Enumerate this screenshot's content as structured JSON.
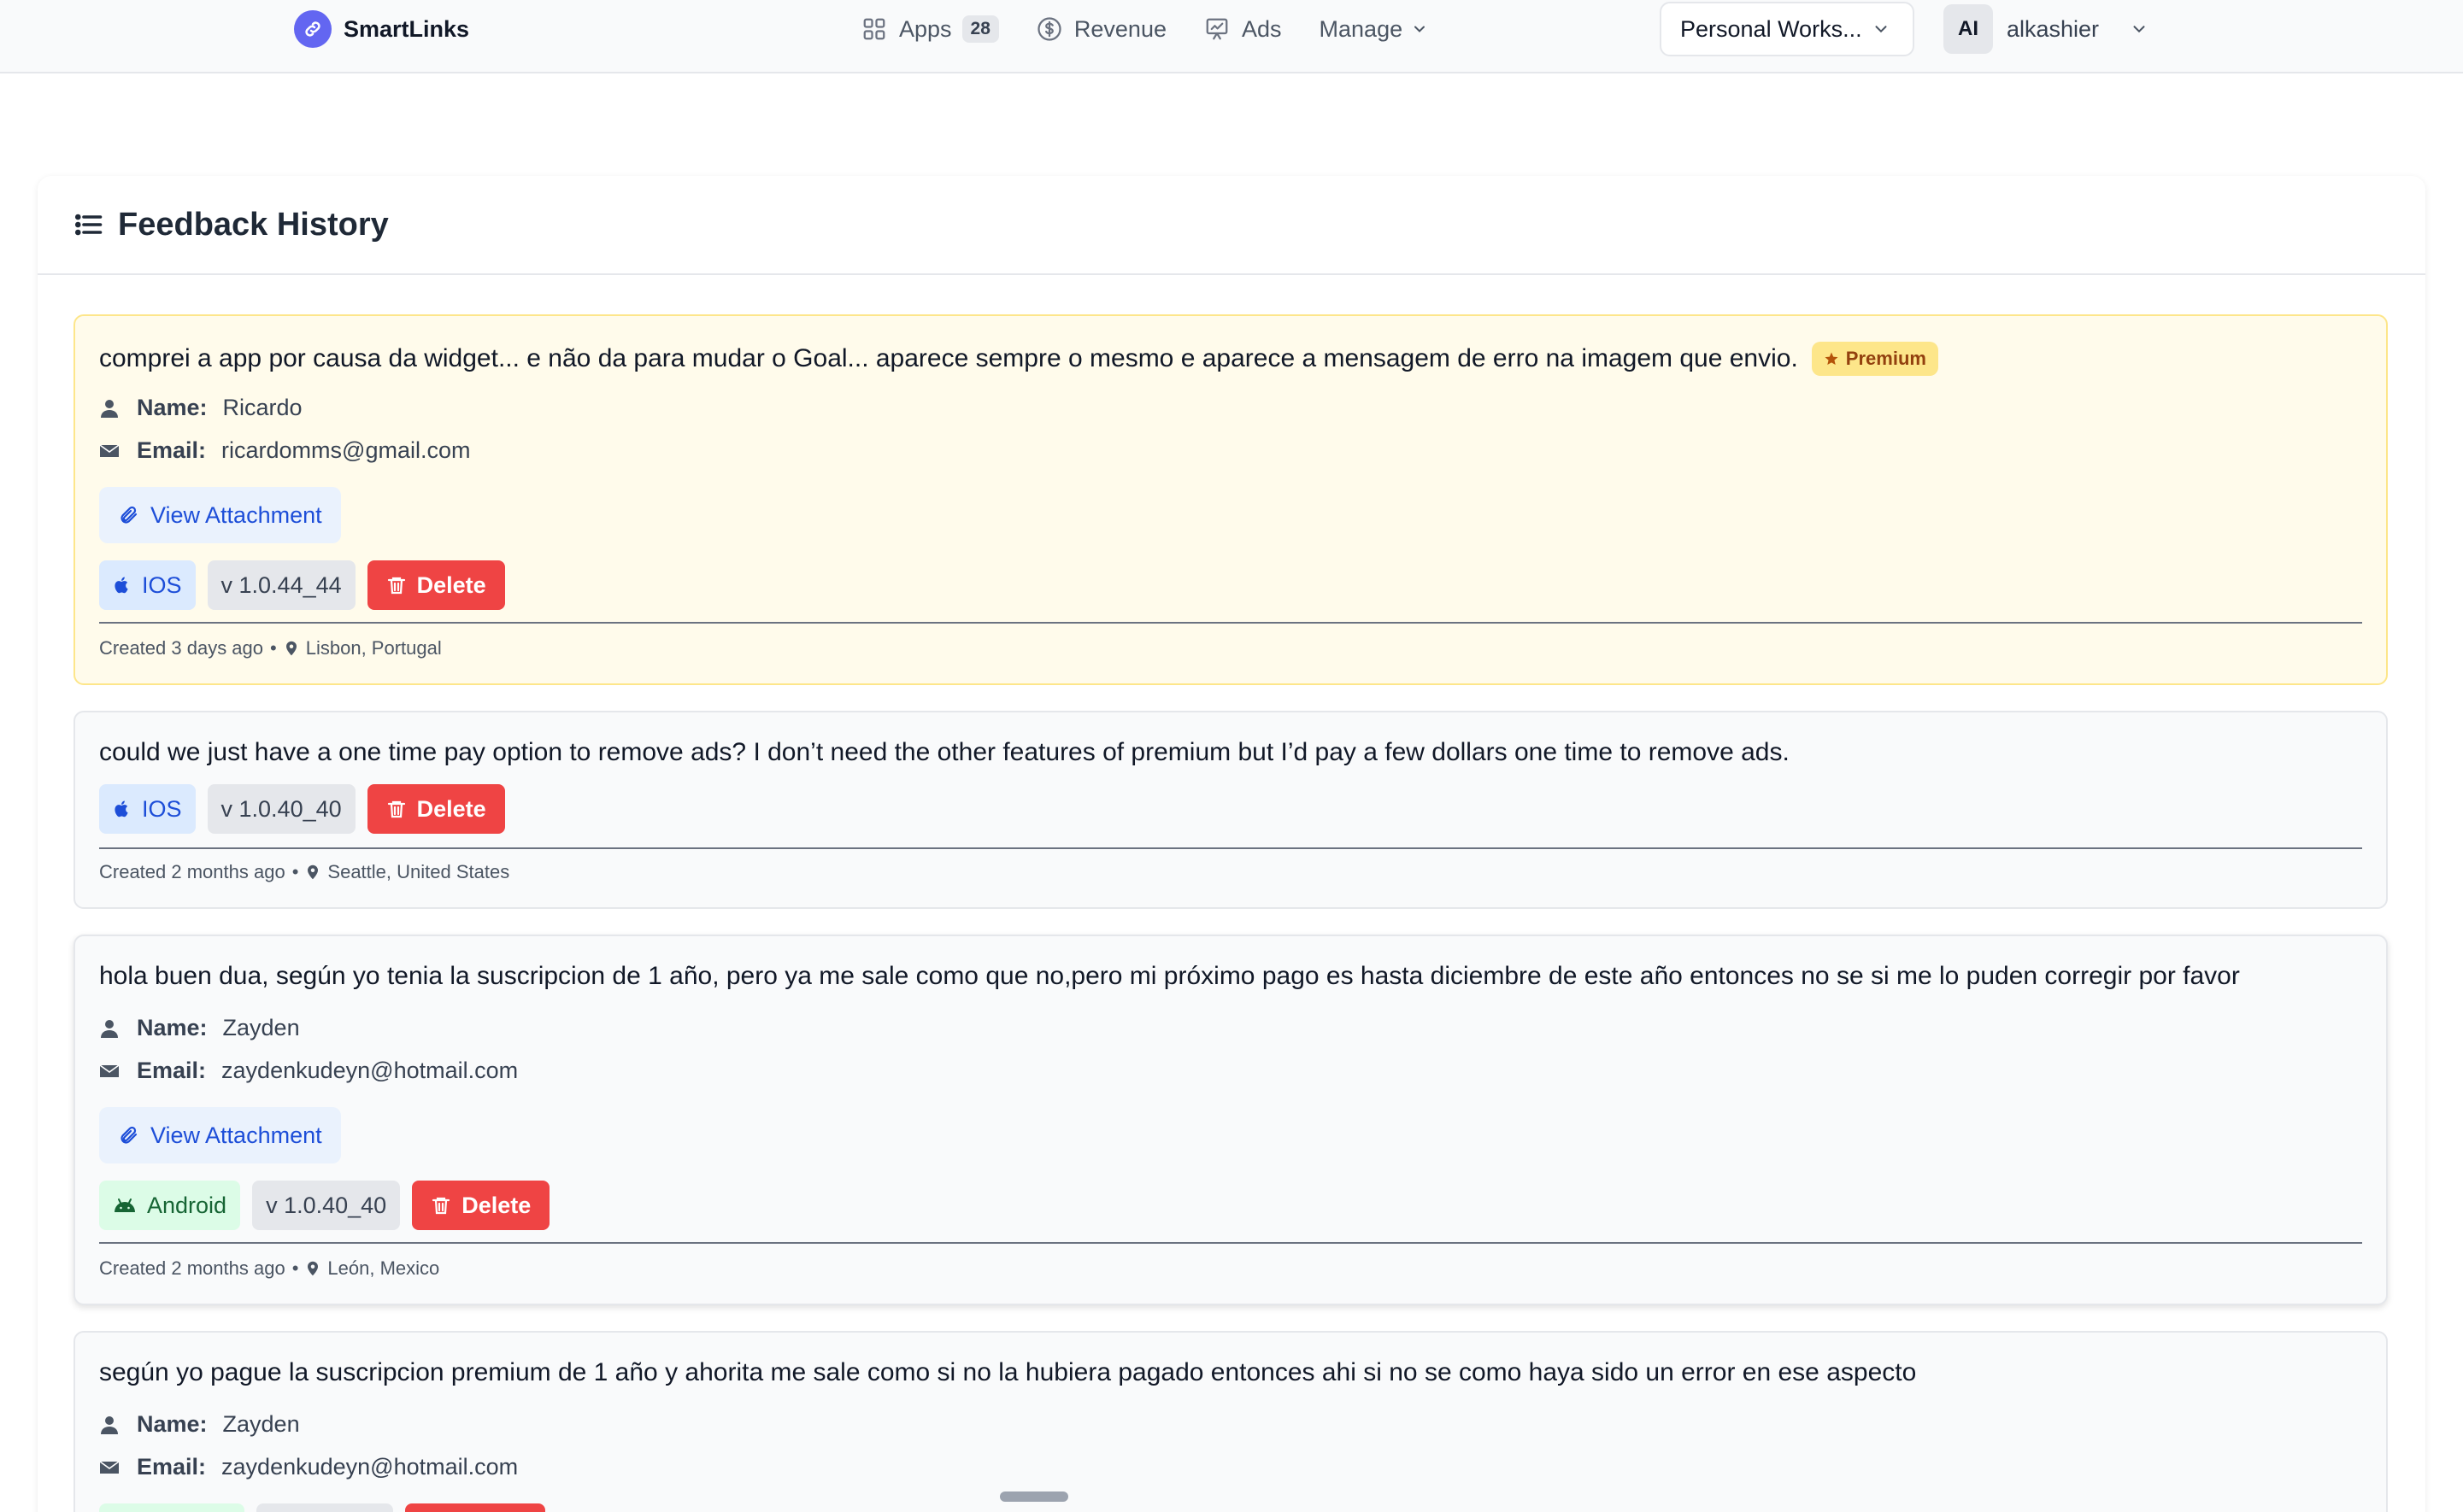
{
  "nav": {
    "brand": "SmartLinks",
    "apps_label": "Apps",
    "apps_count": "28",
    "revenue_label": "Revenue",
    "ads_label": "Ads",
    "manage_label": "Manage",
    "workspace": "Personal Works...",
    "user_initials": "AI",
    "user_name": "alkashier"
  },
  "panel": {
    "title": "Feedback History"
  },
  "labels": {
    "name": "Name:",
    "email": "Email:",
    "view_attachment": "View Attachment",
    "delete": "Delete",
    "premium": "Premium",
    "separator": "•"
  },
  "feedback": [
    {
      "message": "comprei a app por causa da widget... e não da para mudar o Goal... aparece sempre o mesmo e aparece a mensagem de erro na imagem que envio.",
      "premium": true,
      "name": "Ricardo",
      "email": "ricardomms@gmail.com",
      "has_attachment": true,
      "platform": "IOS",
      "version": "v 1.0.44_44",
      "created": "Created 3 days ago",
      "location": "Lisbon, Portugal"
    },
    {
      "message": "could we just have a one time pay option to remove ads? I don’t need the other features of premium but I’d pay a few dollars one time to remove ads.",
      "premium": false,
      "platform": "IOS",
      "version": "v 1.0.40_40",
      "created": "Created 2 months ago",
      "location": "Seattle, United States"
    },
    {
      "message": "hola buen dua, según yo tenia la suscripcion de 1 año, pero ya me sale como que no,pero mi próximo pago es hasta diciembre de este año entonces no se si me lo puden corregir por favor",
      "premium": false,
      "name": "Zayden",
      "email": "zaydenkudeyn@hotmail.com",
      "has_attachment": true,
      "platform": "Android",
      "version": "v 1.0.40_40",
      "created": "Created 2 months ago",
      "location": "León, Mexico"
    },
    {
      "message": "según yo pague la suscripcion premium de 1 año y ahorita me sale como si no la hubiera pagado entonces ahi si no se como haya sido un error en ese aspecto",
      "premium": false,
      "name": "Zayden",
      "email": "zaydenkudeyn@hotmail.com"
    }
  ],
  "colors": {
    "brand": "#6366f1",
    "premium_bg": "#fffbeb",
    "premium_badge": "#fde68a",
    "delete": "#ef4444",
    "ios": "#dbeafe",
    "android": "#dcfce7",
    "attachment": "#eaf2fd"
  },
  "icons": [
    "link-icon",
    "apps-grid-icon",
    "dollar-icon",
    "ads-icon",
    "chevron-down-icon",
    "list-icon",
    "user-icon",
    "mail-icon",
    "paperclip-icon",
    "apple-icon",
    "android-icon",
    "trash-icon",
    "map-pin-icon",
    "star-icon"
  ]
}
